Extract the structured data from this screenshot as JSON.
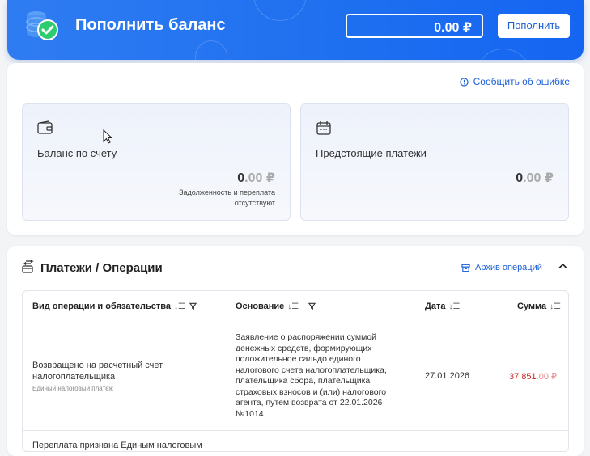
{
  "header": {
    "title": "Пополнить баланс",
    "amount": "0.00  ₽",
    "topup_label": "Пополнить"
  },
  "report_link": "Сообщить об ошибке",
  "balance_card": {
    "label": "Баланс по счету",
    "amount_int": "0",
    "amount_frac": ".00 ₽",
    "note_line1": "Задолженность и переплата",
    "note_line2": "отсутствуют"
  },
  "upcoming_card": {
    "label": "Предстоящие платежи",
    "amount_int": "0",
    "amount_frac": ".00 ₽"
  },
  "payments": {
    "title": "Платежи / Операции",
    "archive_label": "Архив операций",
    "columns": {
      "operation": "Вид операции и обязательства",
      "basis": "Основание",
      "date": "Дата",
      "sum": "Сумма"
    },
    "rows": [
      {
        "operation": "Возвращено на расчетный счет налогоплательщика",
        "operation_sub": "Единый налоговый платеж",
        "basis": "Заявление о распоряжении суммой денежных средств, формирующих положительное сальдо единого налогового счета налогоплательщика, плательщика сбора, плательщика страховых взносов и (или) налогового агента, путем возврата от 22.01.2026 №1014",
        "date": "27.01.2026",
        "sum_int": "37 851",
        "sum_frac": ".00 ₽"
      },
      {
        "operation": "Переплата признана Единым налоговым"
      }
    ]
  },
  "colors": {
    "accent": "#1b5fd8",
    "banner": "#2f7cf2",
    "negative": "#c62828"
  }
}
